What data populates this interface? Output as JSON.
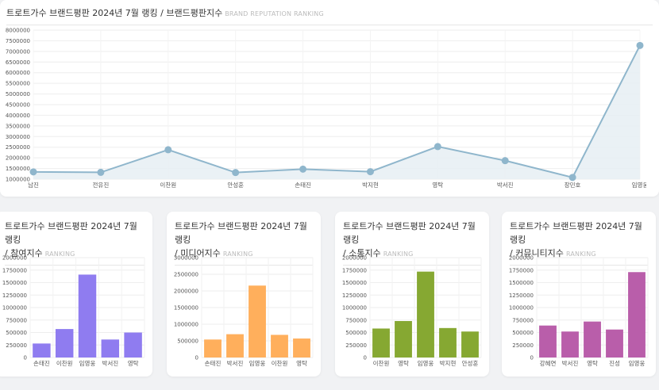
{
  "main": {
    "title": "트로트가수 브랜드평판 2024년 7월 랭킹 / 브랜드평판지수",
    "subtitle": "BRAND REPUTATION RANKING"
  },
  "cards": [
    {
      "title_line1": "트로트가수 브랜드평판 2024년 7월 랭킹",
      "title_line2": "/ 참여지수",
      "subtitle": "RANKING"
    },
    {
      "title_line1": "트로트가수 브랜드평판 2024년 7월 랭킹",
      "title_line2": "/ 미디어지수",
      "subtitle": "RANKING"
    },
    {
      "title_line1": "트로트가수 브랜드평판 2024년 7월 랭킹",
      "title_line2": "/ 소통지수",
      "subtitle": "RANKING"
    },
    {
      "title_line1": "트로트가수 브랜드평판 2024년 7월 랭킹",
      "title_line2": "/ 커뮤니티지수",
      "subtitle": "RANKING"
    }
  ],
  "chart_data": [
    {
      "type": "area",
      "categories": [
        "남진",
        "전유진",
        "이찬원",
        "안성훈",
        "손태진",
        "박지현",
        "영탁",
        "박서진",
        "장민호",
        "임영웅"
      ],
      "values": [
        1340000,
        1320000,
        2380000,
        1310000,
        1470000,
        1350000,
        2530000,
        1870000,
        1080000,
        7280000
      ],
      "ylim": [
        1000000,
        8000000
      ],
      "yticks": [
        1000000,
        1500000,
        2000000,
        2500000,
        3000000,
        3500000,
        4000000,
        4500000,
        5000000,
        5500000,
        6000000,
        6500000,
        7000000,
        7500000,
        8000000
      ],
      "color": "#8fb6cc",
      "grid": true
    },
    {
      "type": "bar",
      "categories": [
        "손태진",
        "이찬원",
        "임영웅",
        "박서진",
        "영탁"
      ],
      "values": [
        280000,
        570000,
        1660000,
        360000,
        500000
      ],
      "ylim": [
        0,
        2000000
      ],
      "yticks": [
        0,
        250000,
        500000,
        750000,
        1000000,
        1250000,
        1500000,
        1750000,
        2000000
      ],
      "color": "#8f7cf0",
      "grid": true
    },
    {
      "type": "bar",
      "categories": [
        "손태진",
        "박서진",
        "임영웅",
        "이찬원",
        "영탁"
      ],
      "values": [
        540000,
        700000,
        2160000,
        680000,
        570000
      ],
      "ylim": [
        0,
        3000000
      ],
      "yticks": [
        0,
        500000,
        1000000,
        1500000,
        2000000,
        2500000,
        3000000
      ],
      "color": "#ffaf5c",
      "grid": true
    },
    {
      "type": "bar",
      "categories": [
        "이찬원",
        "영탁",
        "임영웅",
        "박지현",
        "안성훈"
      ],
      "values": [
        580000,
        730000,
        1720000,
        590000,
        520000
      ],
      "ylim": [
        0,
        2000000
      ],
      "yticks": [
        0,
        250000,
        500000,
        750000,
        1000000,
        1250000,
        1500000,
        1750000,
        2000000
      ],
      "color": "#86a832",
      "grid": true
    },
    {
      "type": "bar",
      "categories": [
        "강혜연",
        "박서진",
        "영탁",
        "진성",
        "임영웅"
      ],
      "values": [
        640000,
        520000,
        720000,
        560000,
        1710000
      ],
      "ylim": [
        0,
        2000000
      ],
      "yticks": [
        0,
        250000,
        500000,
        750000,
        1000000,
        1250000,
        1500000,
        1750000,
        2000000
      ],
      "color": "#b95eaa",
      "grid": true
    }
  ]
}
